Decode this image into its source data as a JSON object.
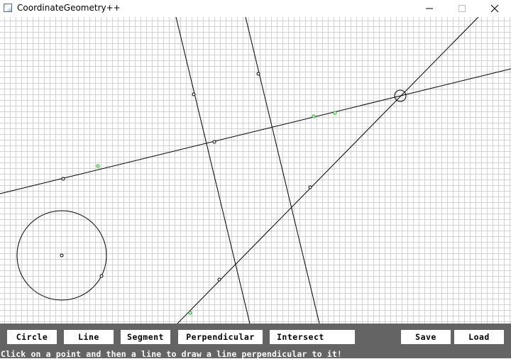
{
  "window": {
    "title": "CoordinateGeometry++",
    "controls": [
      "minimize",
      "maximize",
      "close"
    ]
  },
  "canvas": {
    "grid": true,
    "objects": [
      {
        "kind": "line",
        "name": "long-line-through-two-points"
      },
      {
        "kind": "line",
        "name": "steep-line-left"
      },
      {
        "kind": "line",
        "name": "steep-line-right"
      },
      {
        "kind": "line",
        "name": "diagonal-line"
      },
      {
        "kind": "circle",
        "name": "circle-lower-left"
      },
      {
        "kind": "intersection-marker",
        "name": "selected-intersection"
      }
    ],
    "colors": {
      "grid": "#d2d2d2",
      "stroke": "#000000",
      "highlight_points": "#00b400"
    }
  },
  "toolbar": {
    "circle_label": "Circle",
    "line_label": "Line",
    "segment_label": "Segment",
    "perpendicular_label": "Perpendicular",
    "intersect_label": "Intersect",
    "save_label": "Save",
    "load_label": "Load",
    "background": "#646464"
  },
  "status": {
    "message": "Click on a point and then a line to draw a line perpendicular to it!"
  }
}
